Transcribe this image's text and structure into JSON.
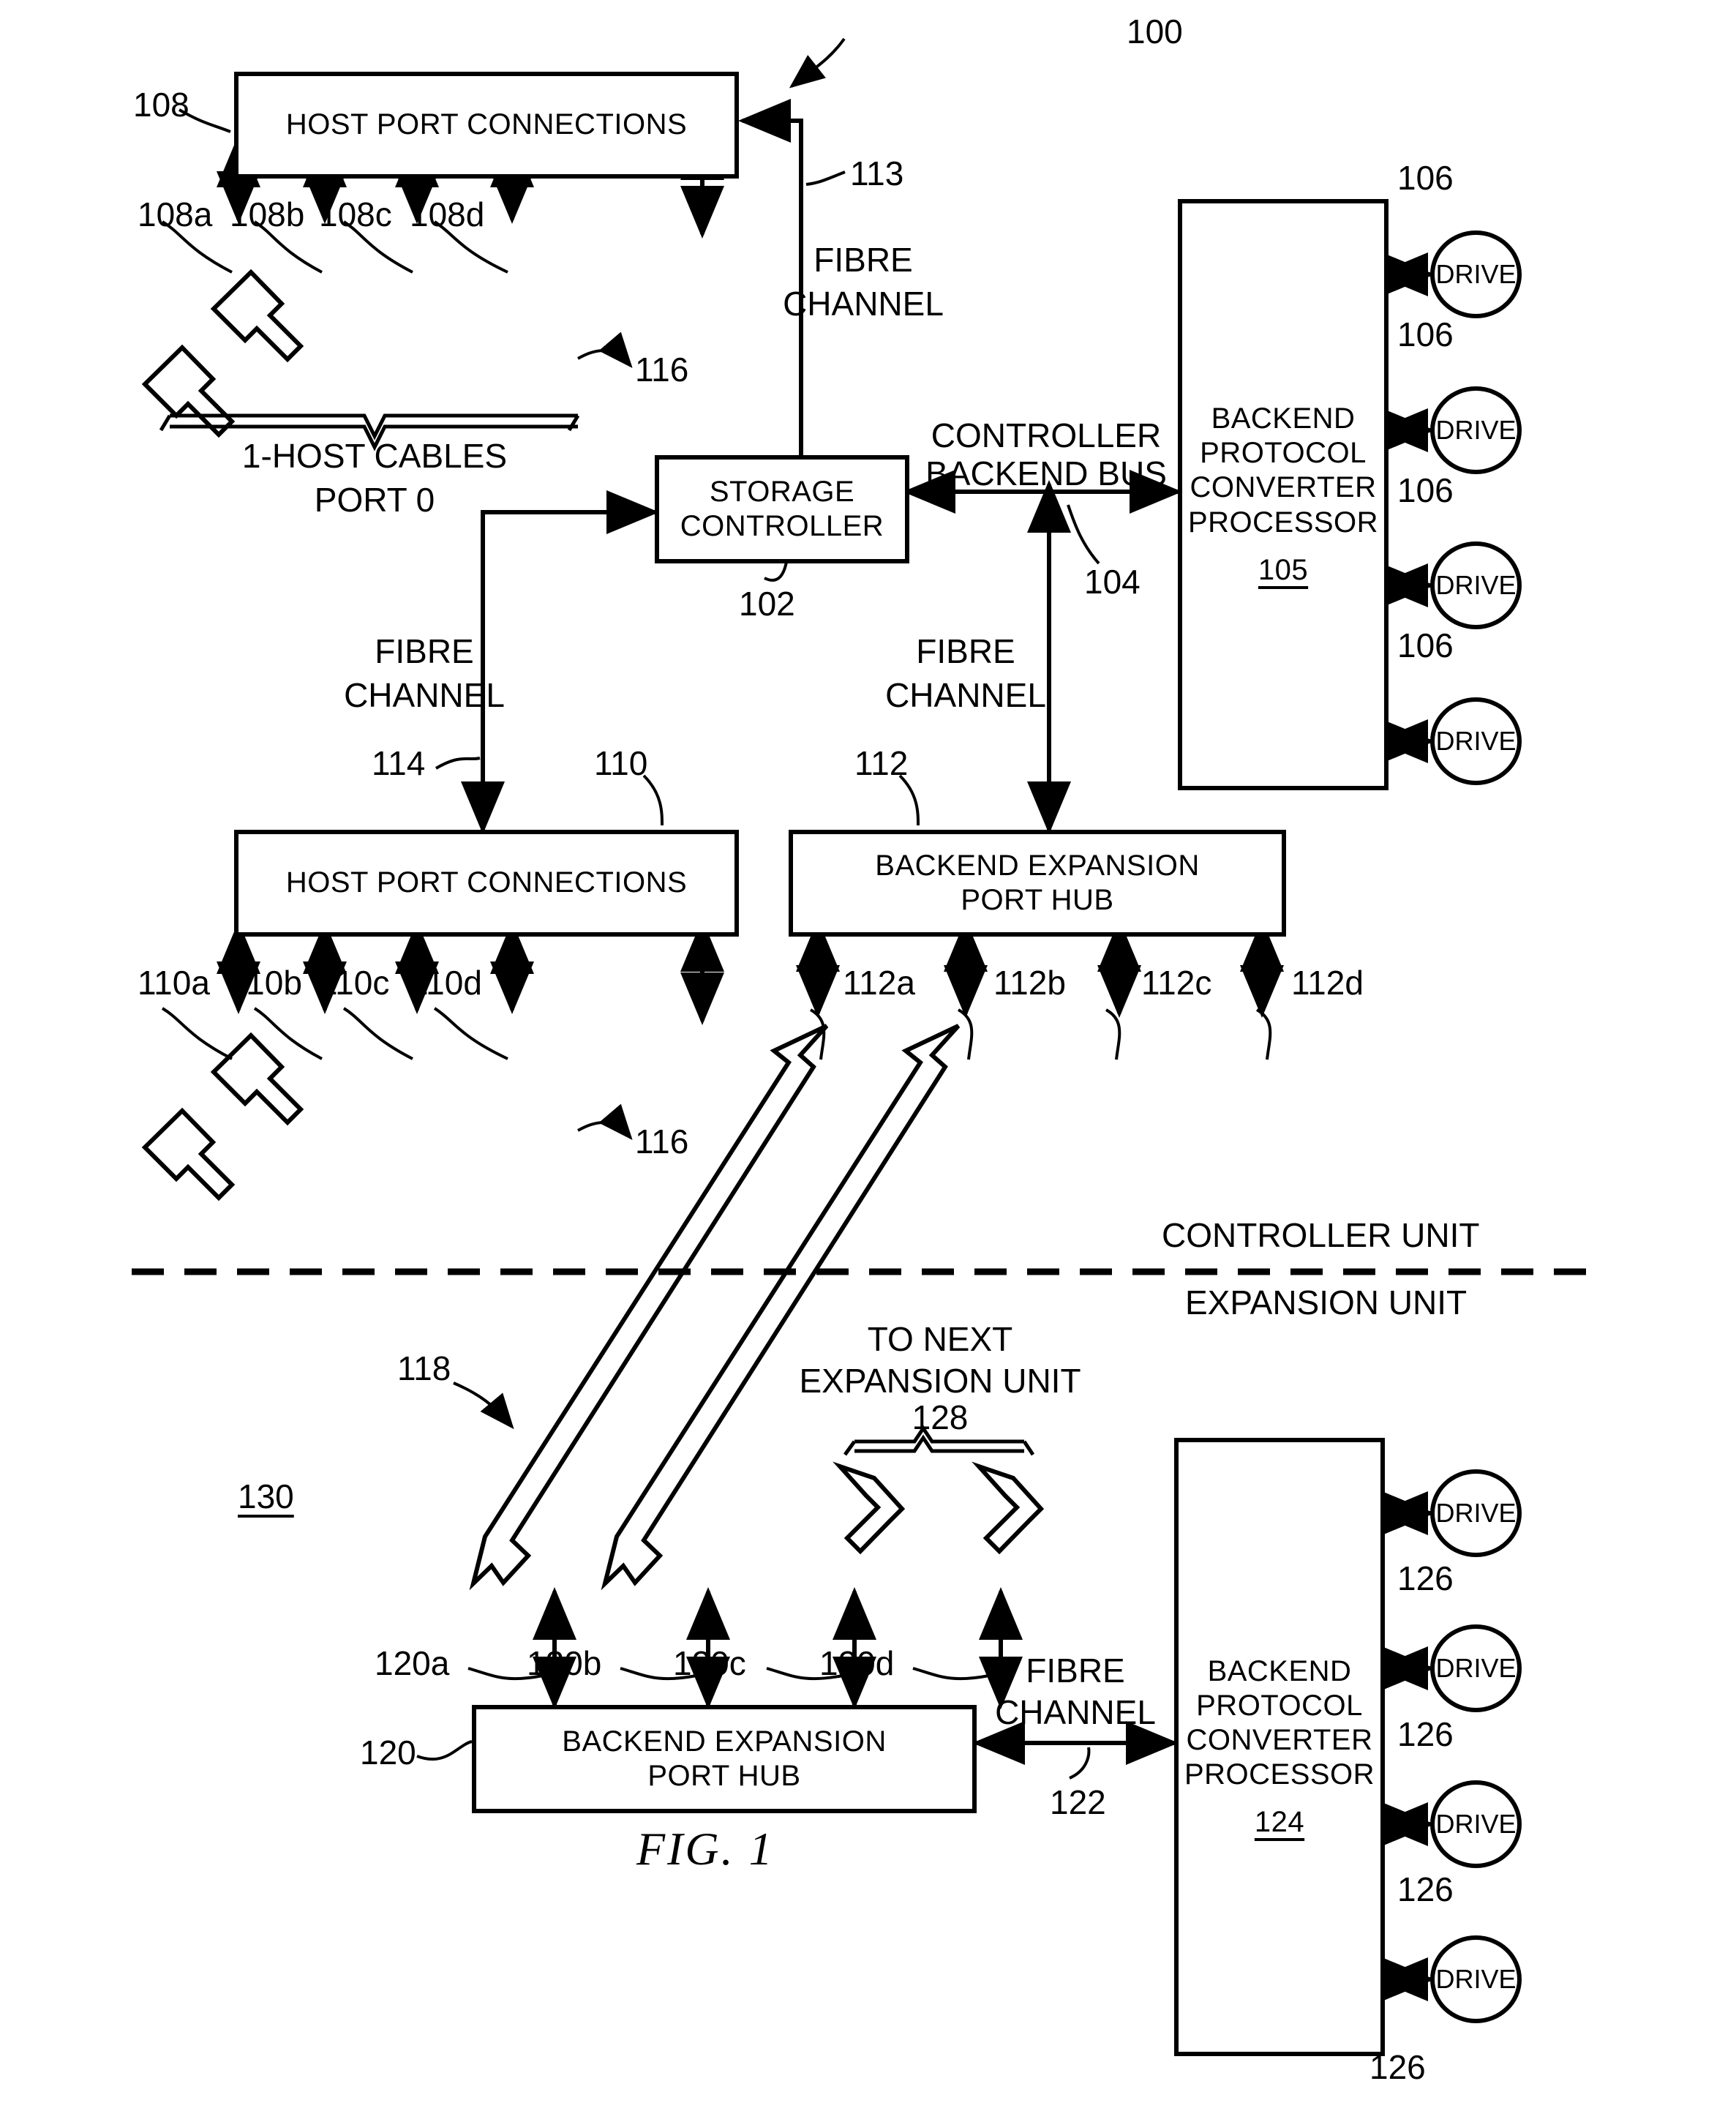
{
  "figure": {
    "caption": "FIG. 1",
    "system_ref": "100",
    "controller_unit_label": "CONTROLLER UNIT",
    "expansion_unit_label": "EXPANSION UNIT",
    "expansion_unit_ref": "130"
  },
  "boxes": {
    "host_port_top": {
      "line1": "HOST PORT CONNECTIONS",
      "ref": "108"
    },
    "host_port_bottom": {
      "line1": "HOST PORT CONNECTIONS",
      "ref": "110"
    },
    "storage_controller": {
      "line1": "STORAGE",
      "line2": "CONTROLLER",
      "ref": "102"
    },
    "backend_hub_top": {
      "line1": "BACKEND EXPANSION",
      "line2": "PORT HUB",
      "ref": "112"
    },
    "backend_hub_bottom": {
      "line1": "BACKEND EXPANSION",
      "line2": "PORT HUB",
      "ref": "120"
    },
    "converter_top": {
      "line1": "BACKEND",
      "line2": "PROTOCOL",
      "line3": "CONVERTER",
      "line4": "PROCESSOR",
      "ref": "105"
    },
    "converter_bottom": {
      "line1": "BACKEND",
      "line2": "PROTOCOL",
      "line3": "CONVERTER",
      "line4": "PROCESSOR",
      "ref": "124"
    }
  },
  "drives": {
    "label": "DRIVE",
    "top_refs": [
      "106",
      "106",
      "106",
      "106"
    ],
    "bottom_refs": [
      "126",
      "126",
      "126",
      "126"
    ]
  },
  "port_refs": {
    "host_top": [
      "108a",
      "108b",
      "108c",
      "108d"
    ],
    "host_bottom": [
      "110a",
      "110b",
      "110c",
      "110d"
    ],
    "hub_top": [
      "112a",
      "112b",
      "112c",
      "112d"
    ],
    "hub_bottom": [
      "120a",
      "120b",
      "120c",
      "120d"
    ]
  },
  "link_labels": {
    "fibre_113": {
      "text1": "FIBRE",
      "text2": "CHANNEL",
      "ref": "113"
    },
    "fibre_114": {
      "text1": "FIBRE",
      "text2": "CHANNEL",
      "ref": "114"
    },
    "fibre_112": {
      "text1": "FIBRE",
      "text2": "CHANNEL",
      "ref": "112"
    },
    "fibre_122": {
      "text1": "FIBRE",
      "text2": "CHANNEL",
      "ref": "122"
    },
    "backend_bus": {
      "text1": "CONTROLLER",
      "text2": "BACKEND BUS",
      "ref": "104"
    }
  },
  "cables": {
    "host_cables_line1": "1-HOST CABLES",
    "host_cables_line2": "PORT 0",
    "host_cables_ref_top": "116",
    "host_cables_ref_bottom": "116",
    "expansion_cable_ref": "118",
    "to_next_line1": "TO NEXT",
    "to_next_line2": "EXPANSION UNIT",
    "to_next_ref": "128"
  }
}
